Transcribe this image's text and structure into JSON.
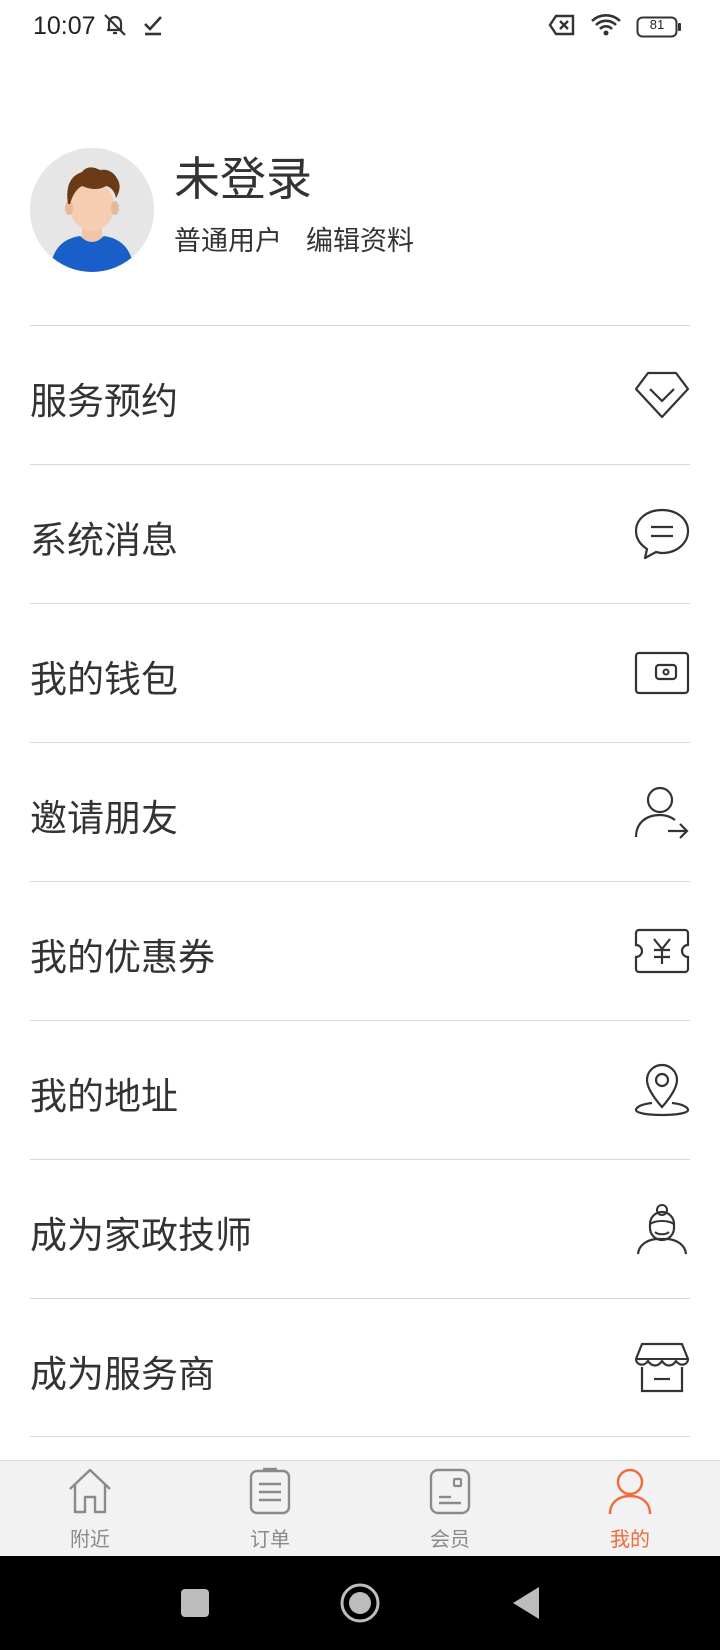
{
  "status_bar": {
    "time": "10:07",
    "battery": "81",
    "icons": [
      "mute-icon",
      "check-icon",
      "sim-off-icon",
      "wifi-icon",
      "battery-icon"
    ]
  },
  "profile": {
    "name": "未登录",
    "user_type": "普通用户",
    "edit_label": "编辑资料",
    "avatar_icon": "user-avatar"
  },
  "menu": {
    "items": [
      {
        "label": "服务预约",
        "icon": "diamond-icon"
      },
      {
        "label": "系统消息",
        "icon": "message-icon"
      },
      {
        "label": "我的钱包",
        "icon": "wallet-icon"
      },
      {
        "label": "邀请朋友",
        "icon": "invite-user-icon"
      },
      {
        "label": "我的优惠券",
        "icon": "coupon-icon"
      },
      {
        "label": "我的地址",
        "icon": "location-pin-icon"
      },
      {
        "label": "成为家政技师",
        "icon": "housekeeper-icon"
      },
      {
        "label": "成为服务商",
        "icon": "store-icon"
      }
    ]
  },
  "tabbar": {
    "tabs": [
      {
        "label": "附近",
        "icon": "home-icon",
        "active": false
      },
      {
        "label": "订单",
        "icon": "order-list-icon",
        "active": false
      },
      {
        "label": "会员",
        "icon": "member-card-icon",
        "active": false
      },
      {
        "label": "我的",
        "icon": "profile-icon",
        "active": true
      }
    ]
  },
  "colors": {
    "accent": "#ef6b3b",
    "text": "#333333",
    "divider": "#d8d8d8",
    "tabbar_bg": "#f2f2f2",
    "inactive": "#8a8a8a"
  }
}
